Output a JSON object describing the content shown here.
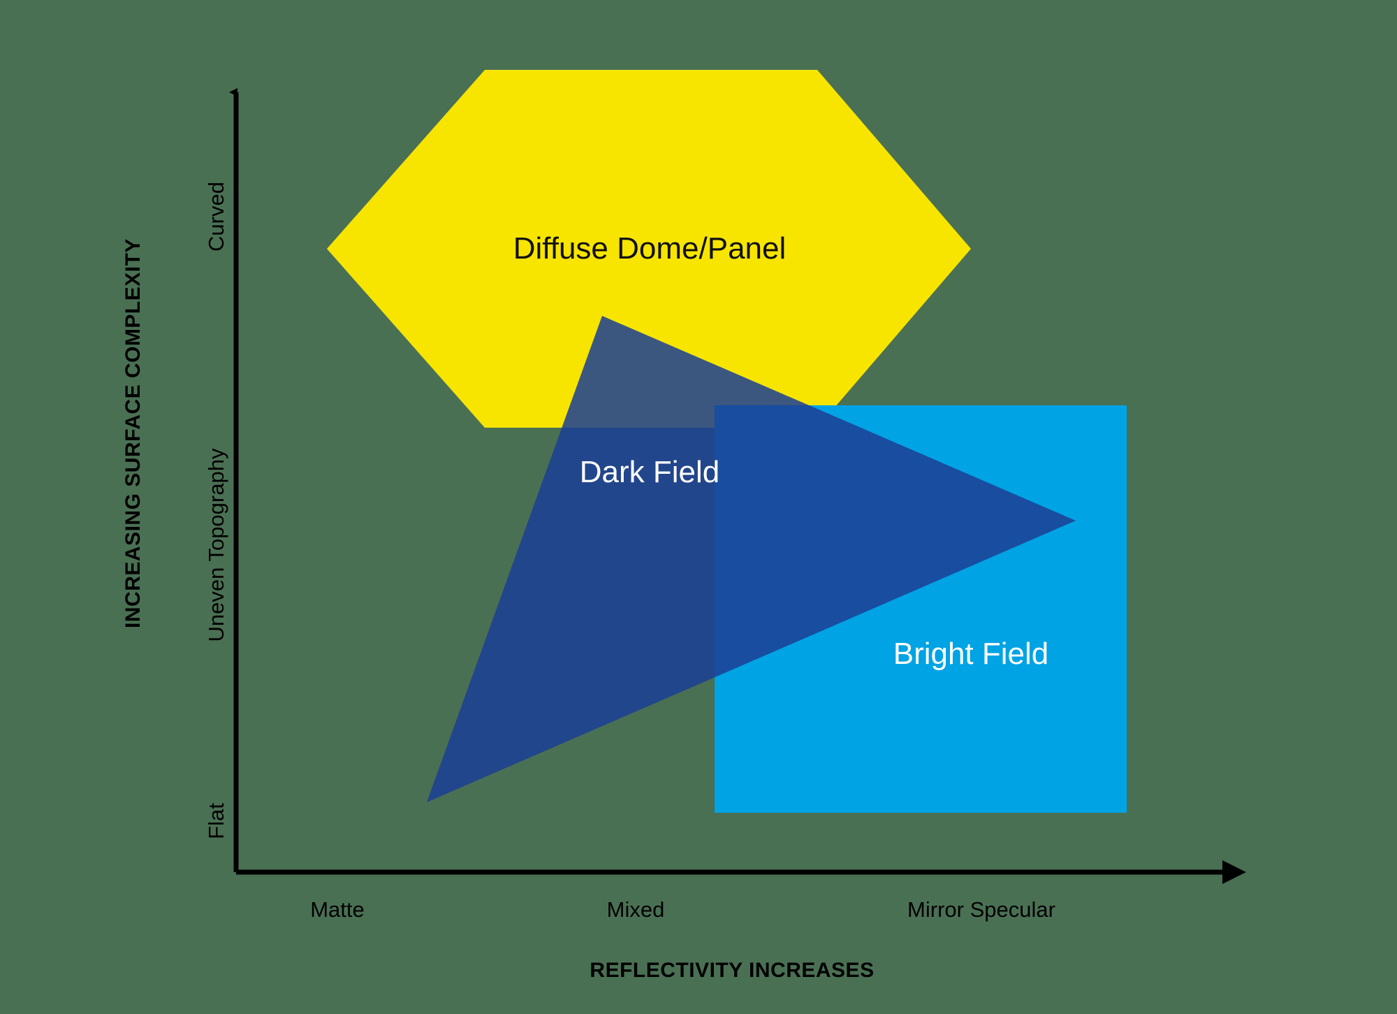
{
  "chart_data": {
    "type": "scatter",
    "title": "",
    "xlabel": "REFLECTIVITY INCREASES",
    "ylabel": "INCREASING SURFACE COMPLEXITY",
    "x_tick_labels": [
      "Matte",
      "Mixed",
      "Mirror Specular"
    ],
    "y_tick_labels": [
      "Flat",
      "Uneven Topography",
      "Curved"
    ],
    "grid": false,
    "legend_position": "none",
    "axis_style": "arrow-ended L axes, black",
    "background_color": "#4a7054",
    "regions": [
      {
        "name": "Diffuse Dome/Panel",
        "shape": "hexagon",
        "color": "#F7E500",
        "opacity": 1.0,
        "x_range": [
          "Matte-Mixed",
          "beyond Mixed toward Mirror Specular"
        ],
        "y_range": [
          "above Uneven Topography",
          "Curved and higher"
        ],
        "label_color": "#111111"
      },
      {
        "name": "Bright Field",
        "shape": "square",
        "color": "#00A3E4",
        "opacity": 1.0,
        "x_range": [
          "Mixed",
          "Mirror Specular"
        ],
        "y_range": [
          "Flat",
          "Uneven Topography"
        ],
        "label_color": "#FFFFFF"
      },
      {
        "name": "Dark Field",
        "shape": "triangle",
        "color": "#1C3F94",
        "opacity": 0.88,
        "x_range": [
          "Matte",
          "Mirror Specular"
        ],
        "y_range": [
          "Flat",
          "just above Uneven Topography"
        ],
        "label_color": "#FFFFFF"
      }
    ]
  },
  "axes": {
    "y_axis_title": "INCREASING SURFACE COMPLEXITY",
    "x_axis_title": "REFLECTIVITY INCREASES",
    "y_ticks": [
      {
        "label": "Curved"
      },
      {
        "label": "Uneven Topography"
      },
      {
        "label": "Flat"
      }
    ],
    "x_ticks": [
      {
        "label": "Matte"
      },
      {
        "label": "Mixed"
      },
      {
        "label": "Mirror Specular"
      }
    ]
  },
  "shapes": {
    "diffuse": {
      "label": "Diffuse Dome/Panel"
    },
    "dark_field": {
      "label": "Dark Field"
    },
    "bright_field": {
      "label": "Bright Field"
    }
  },
  "colors": {
    "background": "#4a7054",
    "yellow": "#F7E500",
    "bright_blue": "#00A3E4",
    "dark_blue": "#1C3F94",
    "axis": "#000000",
    "label_light": "#FFFFFF",
    "label_dark": "#111111"
  }
}
